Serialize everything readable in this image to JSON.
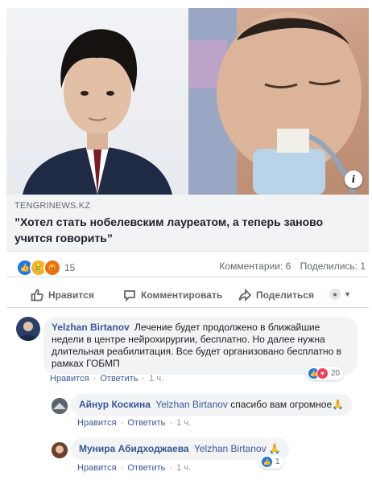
{
  "link_preview": {
    "source": "TENGRINEWS.KZ",
    "headline": "”Хотел стать нобелевским лауреатом, а теперь заново учится говорить”",
    "info_icon": "i"
  },
  "stats": {
    "reaction_icons": [
      "like",
      "sad",
      "angry"
    ],
    "reaction_count": "15",
    "comments": "Комментарии: 6",
    "shares": "Поделились: 1"
  },
  "actions": {
    "like": "Нравится",
    "comment": "Комментировать",
    "share": "Поделиться"
  },
  "comments": [
    {
      "author": "Yelzhan Birtanov",
      "text": "Лечение будет продолжено в ближайшие недели в центре нейрохирургии, бесплатно. Но далее нужна длительная реабилитация. Все будет организовано бесплатно в рамках ГОБМП",
      "like": "Нравится",
      "reply": "Ответить",
      "time": "1 ч.",
      "reaction_count": "20"
    },
    {
      "author": "Айнур Коскина",
      "mention": "Yelzhan Birtanov",
      "text": "спасибо вам огромное🙏",
      "like": "Нравится",
      "reply": "Ответить",
      "time": "1 ч."
    },
    {
      "author": "Мунира Абидходжаева",
      "mention": "Yelzhan Birtanov",
      "text": "🙏",
      "like": "Нравится",
      "reply": "Ответить",
      "time": "1 ч.",
      "reaction_count": "1"
    }
  ],
  "colors": {
    "link": "#385898",
    "muted": "#606770",
    "bubble": "#f2f3f5",
    "like_blue": "#1877f2"
  }
}
